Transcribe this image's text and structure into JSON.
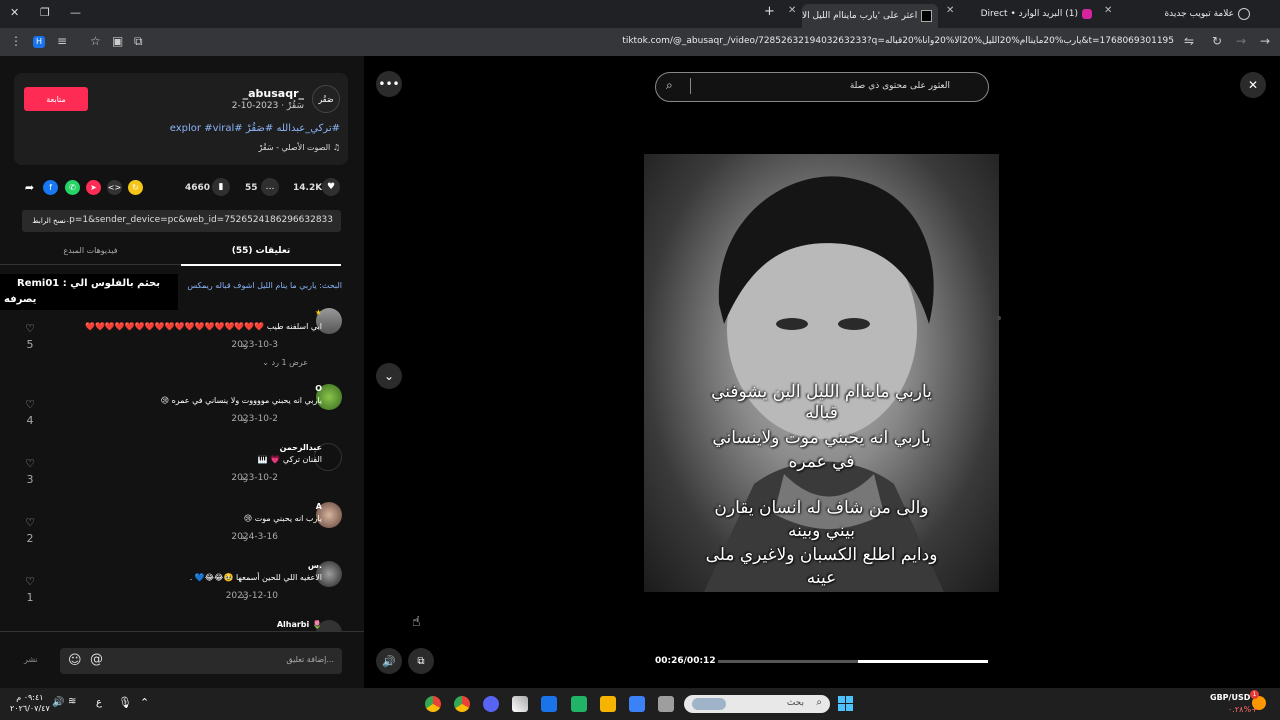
{
  "browser": {
    "tabs": [
      {
        "title": "علامة تبويب جديدة"
      },
      {
        "title": "(1) البريد الوارد • Direct"
      },
      {
        "title": "اعثر على 'يارب مايناام الليل الا"
      }
    ],
    "url": "tiktok.com/@_abusaqr_/video/7285263219403263233?q=يارب%20مايناام%20الليل%20الا%20وانا%20قباله&t=1768069301195"
  },
  "post": {
    "username": "_abusaqr_",
    "display_name": "سَقُرْ",
    "date": "2023-10-2",
    "meta": "سَقُرْ · 2023-10-2",
    "follow_label": "متابعة",
    "caption": "#تركي_عبدالله #صَقُرْ #explor #viral",
    "sound": "الصوت الأصلي - سَقُرْ",
    "avatar_text": "صَقُر"
  },
  "stats": {
    "likes": "14.2K",
    "comments": "55",
    "saves": "4660"
  },
  "link": {
    "text": "...p=1&sender_device=pc&web_id=7526524186296632833",
    "copy_label": "نسخ الرابط"
  },
  "tabs": {
    "comments": "تعليقات (55)",
    "creator_videos": "فيديوهات المبدع"
  },
  "search_hint": "البحث: ياربي ما ينام الليل اشوف قباله ريمكس",
  "overlay": {
    "line1": "بحثم بالفلوس الي : Remi01",
    "line2": "يصرفه"
  },
  "comments": [
    {
      "name": "",
      "text": "ابي اسلفنه طيب ❤️❤️❤️❤️❤️❤️❤️❤️❤️❤️❤️❤️❤️❤️❤️❤️❤️❤️",
      "date": "2023-10-3",
      "reply": "رد",
      "likes": "5",
      "view_replies": "عرض 1 رد"
    },
    {
      "name": "O",
      "text": "ياربي انه يحبني مووووت ولا ينساني في عمره 😢",
      "date": "2023-10-2",
      "reply": "رد",
      "likes": "4"
    },
    {
      "name": "عبدالرحمن",
      "text": "الفنان تركي 💗 🎹",
      "date": "2023-10-2",
      "reply": "رد",
      "likes": "3"
    },
    {
      "name": "A",
      "text": "يارب انه يحبني موت 😢",
      "date": "2024-3-16",
      "reply": "رد",
      "likes": "2"
    },
    {
      "name": "س.",
      "text": "الاعغيه اللي للحين أسمعها 🥹😂😂💙 .",
      "date": "2023-12-10",
      "reply": "رد",
      "likes": "1"
    },
    {
      "name": "Alharbi 🌷",
      "text": "",
      "date": "",
      "reply": "",
      "likes": ""
    }
  ],
  "comment_input": {
    "placeholder": "إضافة تعليق...",
    "post_label": "نشر"
  },
  "video": {
    "search_placeholder": "العثور على محتوى ذي صلة",
    "lyrics": [
      "ياربي مايناام الليل الين يشوفني",
      "قباله",
      "ياربي انه يحبني موت ولاينساني",
      "في عمره",
      "والى من شاف له انسان يقارن",
      "بيني وبينه",
      "ودايم اطلع الكسبان ولاغيري ملى",
      "عينه"
    ],
    "time": "00:26/00:12",
    "progress": 0.48
  },
  "taskbar": {
    "time": "٠٩:٤١ م",
    "date": "٢٠٢٦/٠٧/٤٧",
    "lang": "ع",
    "search_placeholder": "بحث",
    "ticker_name": "GBP/USD",
    "ticker_value": "٠.٢٨%+",
    "notif": "1"
  },
  "colors": {
    "accent": "#fe2c55",
    "link": "#8ab4f8",
    "panel": "#121212"
  }
}
